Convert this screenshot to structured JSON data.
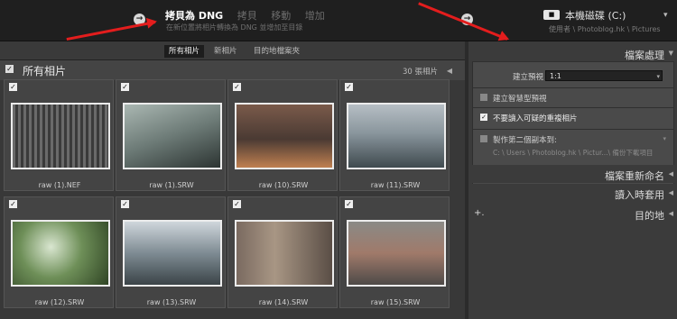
{
  "top": {
    "modes": [
      "拷貝為 DNG",
      "拷貝",
      "移動",
      "增加"
    ],
    "subtitle": "在新位置將相片轉換為 DNG 並增加至目錄",
    "destination_title": "本機磁碟 (C:)",
    "destination_path": "使用者 \\ Photoblog.hk \\ Pictures"
  },
  "library": {
    "tabs": [
      "所有相片",
      "新相片",
      "目的地檔案夾"
    ],
    "all_photos_label": "所有相片",
    "photo_count": "30 張相片",
    "photos": [
      {
        "name": "raw (1).NEF"
      },
      {
        "name": "raw (1).SRW"
      },
      {
        "name": "raw (10).SRW"
      },
      {
        "name": "raw (11).SRW"
      },
      {
        "name": "raw (12).SRW"
      },
      {
        "name": "raw (13).SRW"
      },
      {
        "name": "raw (14).SRW"
      },
      {
        "name": "raw (15).SRW"
      }
    ]
  },
  "panel": {
    "file_handling": "檔案處理",
    "build_previews_label": "建立預視",
    "build_previews_value": "1:1",
    "smart_previews": "建立智慧型預視",
    "no_duplicates": "不要讀入可疑的重複相片",
    "second_copy": "製作第二個副本到:",
    "second_copy_path": "C: \\ Users \\ Photoblog.hk \\ Pictur...\\ 備份下載項目",
    "file_renaming": "檔案重新命名",
    "apply_during_import": "讀入時套用",
    "destination": "目的地",
    "plus": "+."
  },
  "colors": {
    "arrow": "#e31d1d",
    "accent_white": "#ffffff"
  },
  "icons": [
    "left-arrow-circle-icon",
    "right-arrow-circle-icon",
    "disk-icon",
    "checkbox-icon",
    "dropdown-triangle-icon"
  ]
}
